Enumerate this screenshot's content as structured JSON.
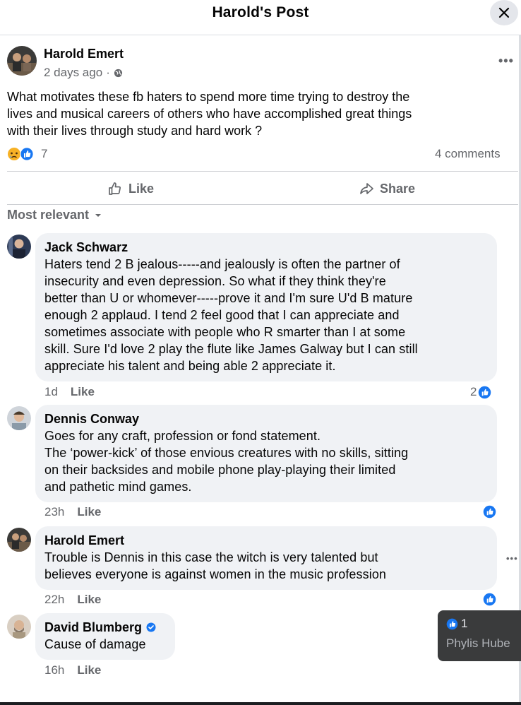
{
  "header": {
    "title": "Harold's Post",
    "close_icon": "close-icon"
  },
  "post": {
    "author": "Harold Emert",
    "time": "2 days ago",
    "separator": "·",
    "privacy_icon": "globe-icon",
    "text_lines": [
      "What motivates these fb haters to spend more time trying to destroy the",
      "lives and musical careers of others who have accomplished great things",
      "with their lives through study and hard work ?"
    ],
    "reaction_icons": [
      "sad-reaction-icon",
      "like-reaction-icon"
    ],
    "reaction_count": "7",
    "comments_count": "4 comments"
  },
  "actions": {
    "like": "Like",
    "share": "Share"
  },
  "sort": {
    "label": "Most relevant"
  },
  "comments": [
    {
      "name": "Jack Schwarz",
      "lines": [
        "Haters tend 2 B jealous-----and jealously is often the partner of",
        "insecurity and even depression. So what if they think they're",
        "better than U or whomever-----prove it and I'm sure U'd B mature",
        "enough 2 applaud. I tend 2 feel good that I can appreciate and",
        "sometimes associate with people who R smarter than I at some",
        "skill. Sure I'd love 2 play the flute like James Galway but I can still",
        "appreciate his talent and being able 2 appreciate it."
      ],
      "time": "1d",
      "like": "Like",
      "likes": "2"
    },
    {
      "name": "Dennis Conway",
      "lines": [
        "Goes for any craft, profession or fond statement.",
        "The ‘power-kick’ of those envious creatures with no skills, sitting",
        "on their backsides and mobile phone play-playing their limited",
        "and pathetic mind games."
      ],
      "time": "23h",
      "like": "Like",
      "likes": ""
    },
    {
      "name": "Harold Emert",
      "lines": [
        "Trouble is Dennis in this case the witch is very talented but",
        "believes everyone is against women in the music profession"
      ],
      "time": "22h",
      "like": "Like",
      "likes": ""
    },
    {
      "name": "David Blumberg",
      "verified": true,
      "lines": [
        "Cause of damage"
      ],
      "time": "16h",
      "like": "Like"
    }
  ],
  "tooltip": {
    "count": "1",
    "name": "Phylis Hube"
  },
  "colors": {
    "accent": "#1877f2",
    "bubble": "#f0f2f5",
    "muted": "#65676b"
  }
}
